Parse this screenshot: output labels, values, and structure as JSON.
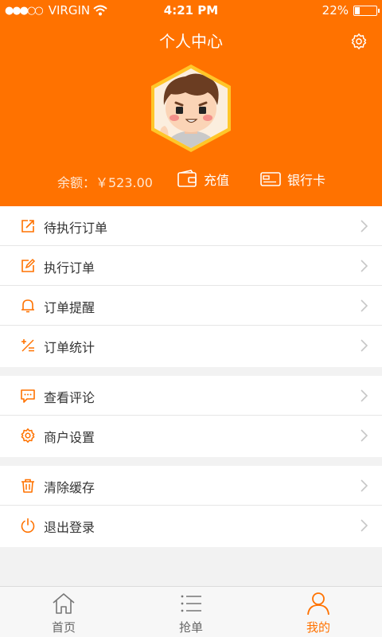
{
  "status_bar": {
    "signal": "●●●○○",
    "carrier": "VIRGIN",
    "time": "4:21 PM",
    "battery": "22%",
    "battery_level": 0.22
  },
  "header": {
    "title": "个人中心",
    "balance": "余额：￥523.00",
    "recharge_label": "充值",
    "bank_card_label": "银行卡"
  },
  "menu": {
    "group1": [
      {
        "label": "待执行订单",
        "icon": "external-order-icon"
      },
      {
        "label": "执行订单",
        "icon": "edit-icon"
      },
      {
        "label": "订单提醒",
        "icon": "bell-icon"
      },
      {
        "label": "订单统计",
        "icon": "plus-minus-icon"
      }
    ],
    "group2": [
      {
        "label": "查看评论",
        "icon": "comment-icon"
      },
      {
        "label": "商户设置",
        "icon": "gear-icon"
      }
    ],
    "group3": [
      {
        "label": "清除缓存",
        "icon": "trash-icon"
      },
      {
        "label": "退出登录",
        "icon": "power-icon"
      }
    ]
  },
  "tabbar": {
    "tabs": [
      {
        "label": "首页",
        "icon": "home-icon"
      },
      {
        "label": "抢单",
        "icon": "list-icon"
      },
      {
        "label": "我的",
        "icon": "user-icon",
        "active": true
      }
    ]
  },
  "colors": {
    "accent": "#ff7200",
    "chevron": "#c7c7c7"
  }
}
